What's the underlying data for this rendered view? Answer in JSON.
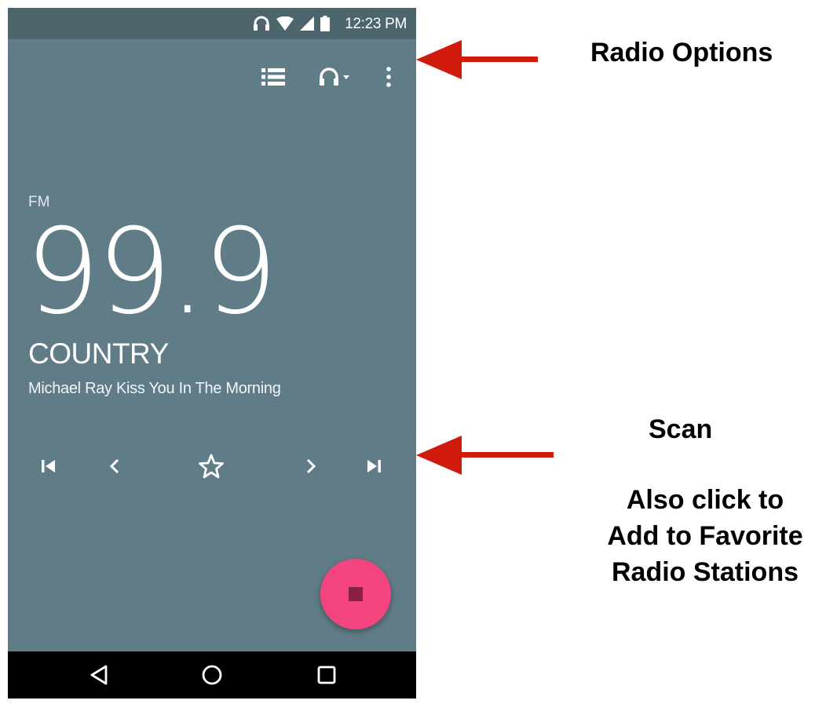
{
  "status_bar": {
    "time": "12:23 PM",
    "icons": [
      "headphones-icon",
      "wifi-icon",
      "signal-icon",
      "battery-icon"
    ]
  },
  "toolbar": {
    "icons": [
      "station-list-icon",
      "headphones-output-icon",
      "more-options-icon"
    ]
  },
  "tuner": {
    "band": "FM",
    "frequency": "99.9",
    "genre": "COUNTRY",
    "now_playing": "Michael Ray Kiss You In The Morning"
  },
  "controls": {
    "icons": [
      "skip-previous-icon",
      "seek-back-icon",
      "favorite-star-icon",
      "seek-forward-icon",
      "skip-next-icon"
    ]
  },
  "fab": {
    "icon": "stop-icon",
    "color": "#f2457f"
  },
  "nav_bar": {
    "icons": [
      "back-icon",
      "home-icon",
      "recents-icon"
    ]
  },
  "annotations": {
    "radio_options": "Radio Options",
    "scan": "Scan",
    "also_click_line1": "Also click to",
    "also_click_line2": "Add to Favorite",
    "also_click_line3": "Radio Stations"
  },
  "colors": {
    "background": "#607d87",
    "status_bar": "#4d656d",
    "arrow": "#d11a0e"
  }
}
